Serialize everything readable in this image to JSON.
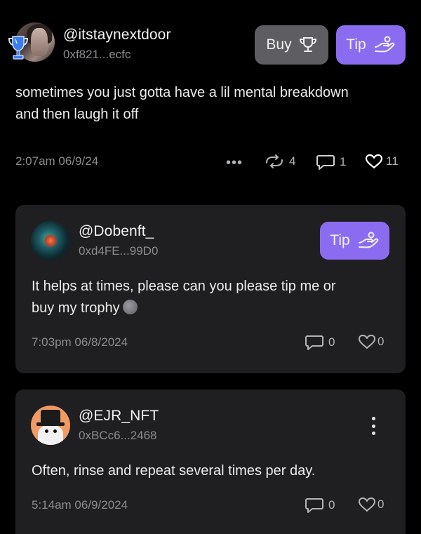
{
  "main_post": {
    "username": "@itstaynextdoor",
    "address": "0xf821...ecfc",
    "buy_label": "Buy",
    "tip_label": "Tip",
    "text_line1": "sometimes you just gotta have a lil mental breakdown",
    "text_line2": "and then laugh it off",
    "timestamp": "2:07am 06/9/24",
    "repost_count": "4",
    "comment_count": "1",
    "like_count": "11"
  },
  "replies": [
    {
      "username": "@Dobenft_",
      "address": "0xd4FE...99D0",
      "tip_label": "Tip",
      "text_line1": "It helps at times, please can you please tip me or",
      "text_line2": "buy my trophy",
      "timestamp": "7:03pm 06/8/2024",
      "comment_count": "0",
      "like_count": "0"
    },
    {
      "username": "@EJR_NFT",
      "address": "0xBCc6...2468",
      "text_line1": "Often, rinse and repeat several times per day.",
      "timestamp": "5:14am 06/9/2024",
      "comment_count": "0",
      "like_count": "0"
    }
  ],
  "colors": {
    "background": "#000000",
    "card": "#1f1f21",
    "accent": "#8b6cf0",
    "buy_button": "#5d5d62",
    "muted_text": "#8c8c90"
  },
  "icons": {
    "trophy_badge": "trophy-icon",
    "buy": "trophy-icon",
    "tip": "tip-hand-icon",
    "more": "ellipsis-icon",
    "repost": "repost-icon",
    "comment": "comment-icon",
    "like": "heart-icon",
    "menu": "kebab-menu-icon"
  }
}
